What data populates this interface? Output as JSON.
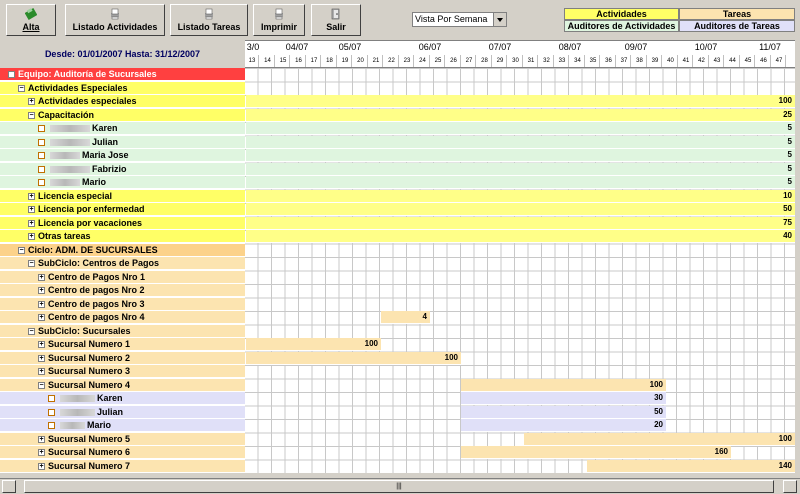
{
  "toolbar": {
    "alta": "Alta",
    "listado_actividades": "Listado Actividades",
    "listado_tareas": "Listado Tareas",
    "imprimir": "Imprimir",
    "salir": "Salir"
  },
  "view_select": {
    "value": "Vista Por Semana"
  },
  "legend": {
    "actividades": "Actividades",
    "tareas": "Tareas",
    "auditores_actividades": "Auditores de Actividades",
    "auditores_tareas": "Auditores de Tareas"
  },
  "date_range": "Desde: 01/01/2007 Hasta: 31/12/2007",
  "months": [
    "3/0",
    "04/07",
    "05/07",
    "06/07",
    "07/07",
    "08/07",
    "09/07",
    "10/07",
    "11/07"
  ],
  "weeks": [
    "13",
    "14",
    "15",
    "16",
    "17",
    "18",
    "19",
    "20",
    "21",
    "22",
    "23",
    "24",
    "25",
    "26",
    "27",
    "28",
    "29",
    "30",
    "31",
    "32",
    "33",
    "34",
    "35",
    "36",
    "37",
    "38",
    "39",
    "40",
    "41",
    "42",
    "43",
    "44",
    "45",
    "46",
    "47"
  ],
  "rows": [
    {
      "label": "Equipo: Auditoría de Sucursales",
      "value": ""
    },
    {
      "label": "Actividades Especiales",
      "value": ""
    },
    {
      "label": "Actividades especiales",
      "value": "100"
    },
    {
      "label": "Capacitación",
      "value": "25"
    },
    {
      "label": "Karen",
      "value": "5"
    },
    {
      "label": "Julian",
      "value": "5"
    },
    {
      "label": "Maria Jose",
      "value": "5"
    },
    {
      "label": "Fabrizio",
      "value": "5"
    },
    {
      "label": "Mario",
      "value": "5"
    },
    {
      "label": "Licencia especial",
      "value": "10"
    },
    {
      "label": "Licencia por enfermedad",
      "value": "50"
    },
    {
      "label": "Licencia por vacaciones",
      "value": "75"
    },
    {
      "label": "Otras tareas",
      "value": "40"
    },
    {
      "label": "Ciclo: ADM. DE SUCURSALES",
      "value": ""
    },
    {
      "label": "SubCiclo: Centros de Pagos",
      "value": ""
    },
    {
      "label": "Centro de Pagos Nro 1",
      "value": ""
    },
    {
      "label": "Centro de pagos Nro 2",
      "value": ""
    },
    {
      "label": "Centro de pagos Nro 3",
      "value": ""
    },
    {
      "label": "Centro de pagos Nro 4",
      "value": "4"
    },
    {
      "label": "SubCiclo: Sucursales",
      "value": ""
    },
    {
      "label": "Sucursal Numero 1",
      "value": "100"
    },
    {
      "label": "Sucursal Numero 2",
      "value": "100"
    },
    {
      "label": "Sucursal Numero 3",
      "value": ""
    },
    {
      "label": "Sucursal Numero 4",
      "value": "100"
    },
    {
      "label": "Karen",
      "value": "30"
    },
    {
      "label": "Julian",
      "value": "50"
    },
    {
      "label": "Mario",
      "value": "20"
    },
    {
      "label": "Sucursal Numero 5",
      "value": "100"
    },
    {
      "label": "Sucursal Numero 6",
      "value": "160"
    },
    {
      "label": "Sucursal Numero 7",
      "value": "140"
    }
  ],
  "scrollbar": {
    "thumb_grip": "|||"
  }
}
